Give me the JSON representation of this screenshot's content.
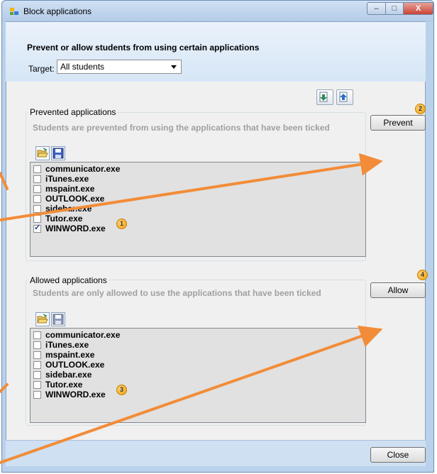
{
  "window": {
    "title": "Block applications",
    "app_icon": "app-icon",
    "min": "–",
    "max": "□",
    "close": "X"
  },
  "header": {
    "heading": "Prevent or allow students from using certain applications",
    "target_label": "Target:",
    "target_value": "All students"
  },
  "toolbar": {
    "icons": [
      "export-icon",
      "import-icon"
    ]
  },
  "prevented": {
    "title": "Prevented applications",
    "description": "Students are prevented from using the applications that have been ticked",
    "open_icon": "open-folder-icon",
    "save_icon": "save-icon",
    "items": [
      {
        "label": "communicator.exe",
        "checked": false
      },
      {
        "label": "iTunes.exe",
        "checked": false
      },
      {
        "label": "mspaint.exe",
        "checked": false
      },
      {
        "label": "OUTLOOK.exe",
        "checked": false
      },
      {
        "label": "sidebar.exe",
        "checked": false
      },
      {
        "label": "Tutor.exe",
        "checked": false
      },
      {
        "label": "WINWORD.exe",
        "checked": true
      }
    ],
    "button": "Prevent"
  },
  "allowed": {
    "title": "Allowed applications",
    "description": "Students are only allowed to use the applications that have been ticked",
    "open_icon": "open-folder-icon",
    "save_icon": "save-icon",
    "items": [
      {
        "label": "communicator.exe",
        "checked": false
      },
      {
        "label": "iTunes.exe",
        "checked": false
      },
      {
        "label": "mspaint.exe",
        "checked": false
      },
      {
        "label": "OUTLOOK.exe",
        "checked": false
      },
      {
        "label": "sidebar.exe",
        "checked": false
      },
      {
        "label": "Tutor.exe",
        "checked": false
      },
      {
        "label": "WINWORD.exe",
        "checked": false
      }
    ],
    "button": "Allow"
  },
  "badges": {
    "b1": "1",
    "b2": "2",
    "b3": "3",
    "b4": "4"
  },
  "footer": {
    "close_button": "Close"
  },
  "colors": {
    "annotation_arrow": "#f28c38",
    "badge": "#f0a000"
  }
}
